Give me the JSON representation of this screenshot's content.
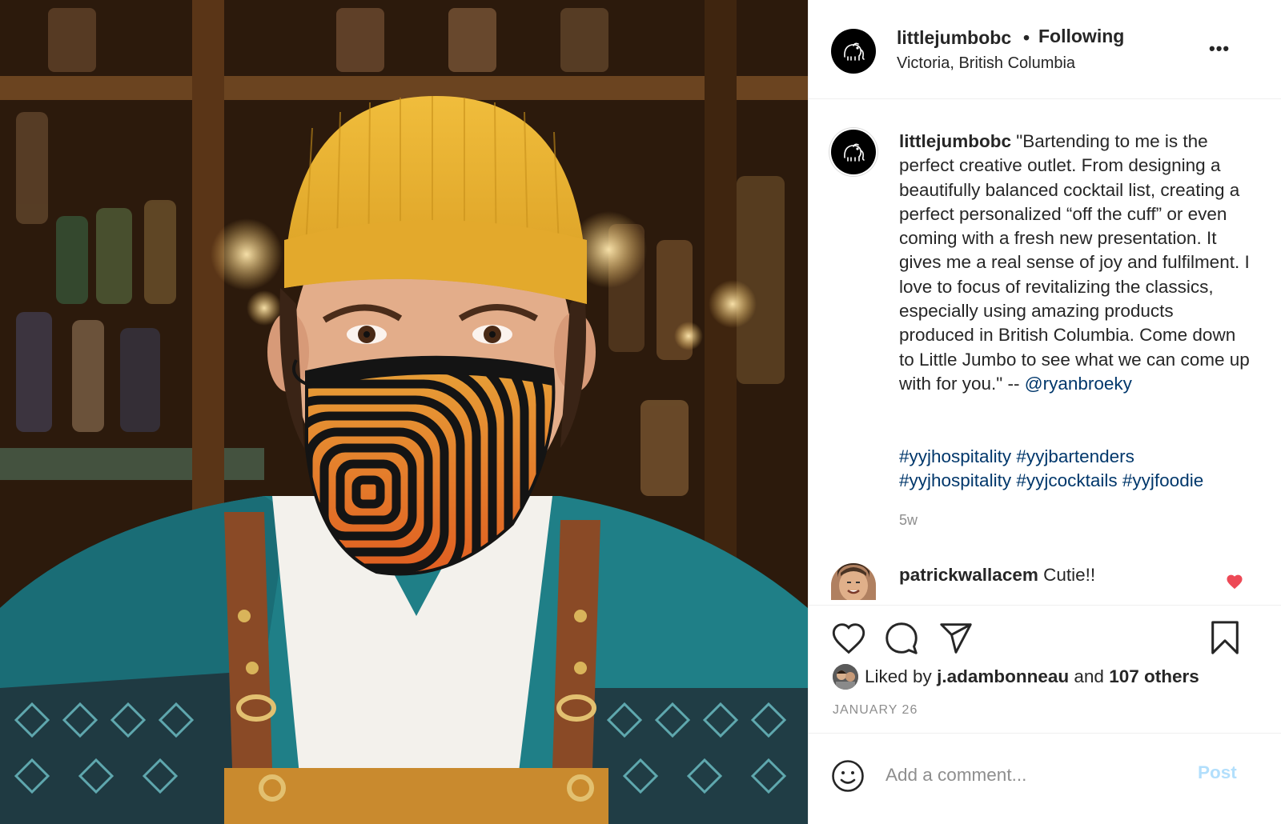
{
  "post": {
    "username": "littlejumbobc",
    "follow_status": "Following",
    "location": "Victoria, British Columbia",
    "more_icon": "more-horizontal-icon",
    "more_label": "•••"
  },
  "caption": {
    "username": "littlejumbobc",
    "text": "\"Bartending to me is the perfect creative outlet. From designing a beautifully balanced cocktail list, creating a perfect personalized “off the cuff” or even coming with a fresh new presentation. It gives me a real sense of joy and fulfilment. I love to focus of revitalizing the classics, especially using amazing products produced in British Columbia. Come down to Little Jumbo to see what we can come up with for you.\" -- ",
    "mention": "@ryanbroeky",
    "hashtags_line1": [
      "#yyjhospitality",
      "#yyjbartenders"
    ],
    "hashtags_line2": [
      "#yyjhospitality",
      "#yyjcocktails",
      "#yyjfoodie"
    ],
    "age": "5w"
  },
  "comments": [
    {
      "username": "patrickwallacem",
      "text": "Cutie!!",
      "liked": true
    }
  ],
  "likes": {
    "prefix": "Liked by",
    "user": "j.adambonneau",
    "and": "and",
    "others": "107 others"
  },
  "date": "JANUARY 26",
  "add_comment": {
    "placeholder": "Add a comment...",
    "post_label": "Post"
  },
  "colors": {
    "link": "#00376b",
    "heart_red": "#ed4956",
    "post_disabled": "#b2dffc",
    "muted": "#8e8e8e"
  }
}
